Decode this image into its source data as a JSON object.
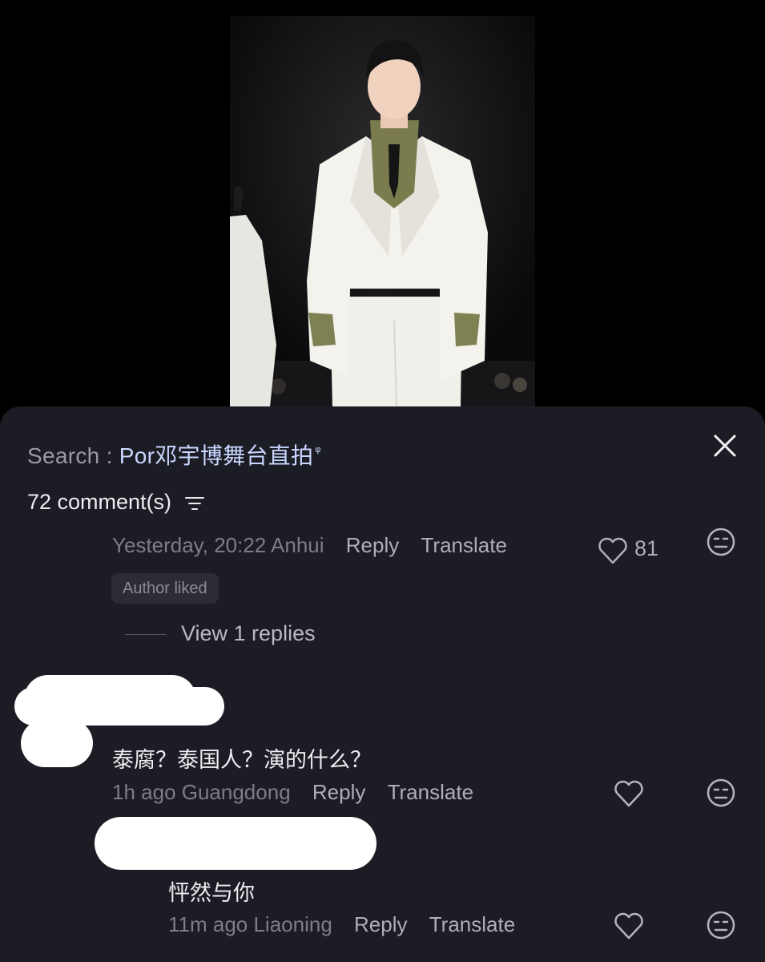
{
  "search": {
    "label": "Search : ",
    "term": "Por邓宇博舞台直拍",
    "glyph": "ᵠ"
  },
  "comments_header": {
    "count_label": "72 comment(s)"
  },
  "comments": [
    {
      "meta": "Yesterday, 20:22 Anhui",
      "reply_label": "Reply",
      "translate_label": "Translate",
      "likes": "81",
      "badge": "Author liked",
      "view_replies": "View 1 replies"
    },
    {
      "text": "泰腐？泰国人？演的什么？",
      "meta": "1h ago Guangdong",
      "reply_label": "Reply",
      "translate_label": "Translate"
    },
    {
      "text": "怦然与你",
      "meta": "11m ago Liaoning",
      "reply_label": "Reply",
      "translate_label": "Translate"
    }
  ],
  "colors": {
    "sheet_bg": "#1c1c24",
    "link": "#c9d7ff",
    "muted": "#7d7d86"
  }
}
